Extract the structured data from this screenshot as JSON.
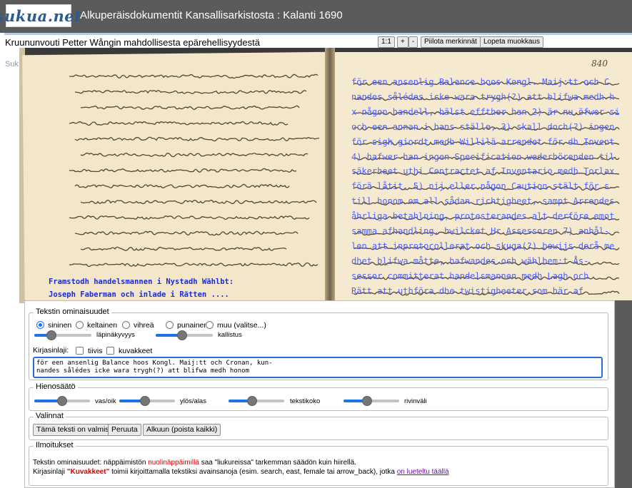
{
  "header": {
    "logo": "sukua.net",
    "title": "Alkuperäisdokumentit Kansallisarkistosta : Kalanti 1690"
  },
  "document": {
    "title": "Kruununvouti Petter Wångin mahdollisesta epärehellisyydestä",
    "page_number": "840",
    "behind_text": "Suk"
  },
  "toolbar": {
    "zoom_1_1": "1:1",
    "zoom_in": "+",
    "zoom_out": "-",
    "hide_marks": "Piilota merkinnät",
    "stop_edit": "Lopeta muokkaus"
  },
  "transcription_lines": [
    "för een ansenlig Balance hoos Kongl. Maij:tt och C",
    "nandes sålédes icke wara trygh(?) att blifwa medh h",
    "x någon handell, hälst effther han 2) är nu öfwer si",
    "och een annan i hans ställe, 3) skall doch(?) ingen",
    "för sigh giordt medh Willilä arrendet för dh Invent",
    "4) hafwer han ingen Specification wederbörenden til",
    "säkerheet uthi Contractet af Inventario medh Torlax",
    "förä låtit, 5) nij eller någon Caution stält för s",
    "till honom om all sådan richtigheet, sampt Arrendes",
    "åhrliga betahlning, protesterandes alt derföre emot",
    "samma afhandling, hwilcket Hr Assessoren 7) anhål-",
    "len att inprotocollerat och skuga(?) bewijs derå me",
    "dhet blifwa måtte, hafwandes och wählbem:t Ås-",
    "sessor committerat handelsmannen medh Lagh och",
    "Rätt att uthföra dhe twistigheeter som här af"
  ],
  "left_overlay": [
    "Framstodh handelsmannen i Nystadh Wählbt:",
    "Joseph Faberman och inlade i Rätten ...."
  ],
  "text_props": {
    "legend": "Tekstin ominaisuudet",
    "colors": [
      {
        "label": "sininen",
        "checked": true
      },
      {
        "label": "keltainen",
        "checked": false
      },
      {
        "label": "vihreä",
        "checked": false
      },
      {
        "label": "punainen",
        "checked": false
      },
      {
        "label": "muu (valitse...)",
        "checked": false
      }
    ],
    "opacity_label": "läpinäkyvyys",
    "tilt_label": "kallistus",
    "opacity_value": 0.25,
    "tilt_value": 0.45
  },
  "font": {
    "label": "Kirjasinlaji:",
    "dense_label": "tiivis",
    "images_label": "kuvakkeet",
    "input_text": "för een ansenlig Balance hoos Kongl. Maij:tt och Cronan, kun-\nnandes sålédes icke wara trygh(?) att blifwa medh honom"
  },
  "fine_tune": {
    "legend": "Hienosäätö",
    "left_right": "vas/oik",
    "up_down": "ylös/alas",
    "text_size": "tekstikoko",
    "line_spacing": "rivinväli",
    "left_right_value": 0.5,
    "up_down_value": 0.45,
    "text_size_value": 0.4,
    "line_spacing_value": 0.4
  },
  "options": {
    "legend": "Valinnat",
    "done": "Tämä teksti on valmis",
    "cancel": "Peruuta",
    "reset": "Alkuun (poista kaikki)"
  },
  "notices": {
    "legend": "Ilmoitukset",
    "line1_a": "Tekstin ominaisuudet: näppäimistön",
    "line1_b": "nuolinäppäimillä",
    "line1_c": "saa \"liukureissa\" tarkemman säädön kuin hiirellä.",
    "line2_a": "Kirjasinlaji",
    "line2_b": "\"Kuvakkeet\"",
    "line2_c": "toimii kirjoittamalla tekstiksi avainsanoja (esim. search, east, female tai arrow_back), jotka",
    "line2_d": "on lueteltu täällä"
  },
  "colors": {
    "header_bg": "#5b5b5b",
    "accent": "#1a73e8",
    "overlay_text": "#4f63ff",
    "notice_red": "#d40000"
  }
}
